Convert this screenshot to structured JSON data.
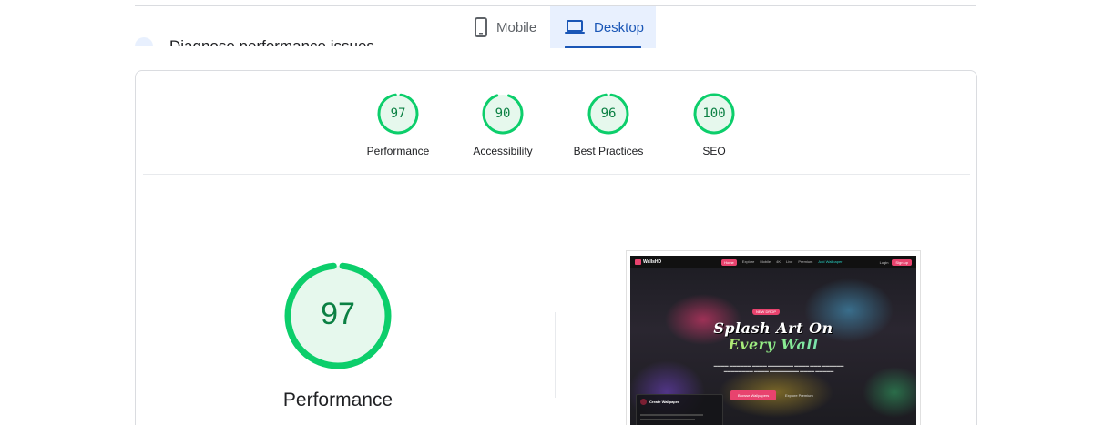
{
  "tabs": {
    "mobile_label": "Mobile",
    "desktop_label": "Desktop",
    "selected": "Desktop"
  },
  "diagnose": {
    "text": "Diagnose performance issues"
  },
  "scores": [
    {
      "value": 97,
      "label": "Performance"
    },
    {
      "value": 90,
      "label": "Accessibility"
    },
    {
      "value": 96,
      "label": "Best Practices"
    },
    {
      "value": 100,
      "label": "SEO"
    }
  ],
  "main_gauge": {
    "value": 97,
    "label": "Performance"
  },
  "colors": {
    "pass_green": "#0cce6b",
    "pass_text": "#0b8043",
    "pass_fill": "#e6f8ed",
    "tab_selected_bg": "#e8f0fe",
    "tab_selected_fg": "#1a56b6"
  },
  "preview": {
    "logo": "WallsHD",
    "nav_links": [
      "Home",
      "Explore",
      "Mobile",
      "4K",
      "Live",
      "Premium",
      "Add Wallpaper"
    ],
    "login": "Login",
    "signup": "Sign up",
    "badge": "NEW DROP",
    "headline_line1": "Splash Art On",
    "headline_line2": "Every Wall",
    "cta_primary": "Browse Wallpapers",
    "cta_secondary": "Explore Premium",
    "panel_title": "Create Wallpaper"
  }
}
